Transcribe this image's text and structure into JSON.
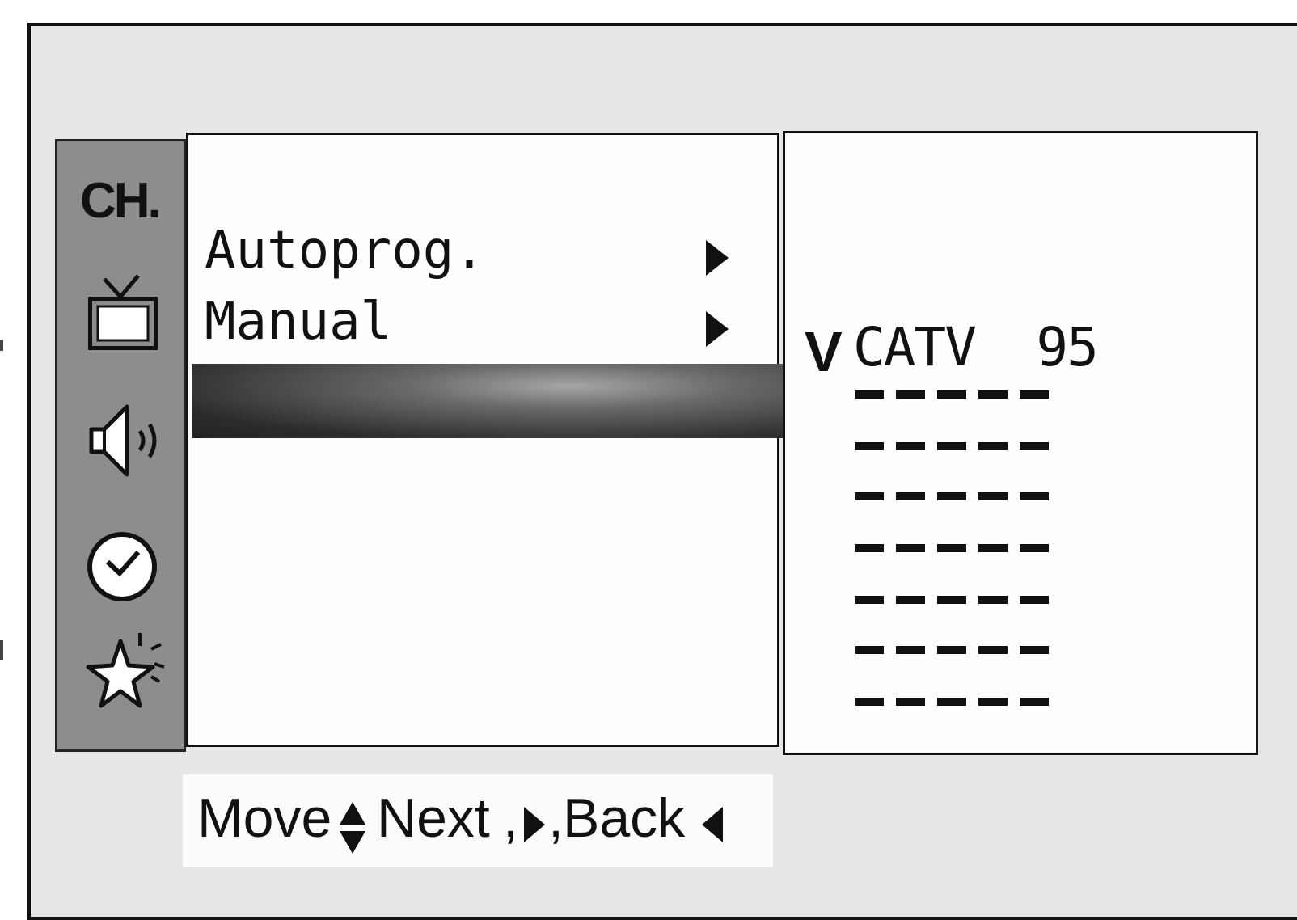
{
  "sidebar": {
    "category_label": "CH.",
    "icons": [
      "tv-icon",
      "speaker-icon",
      "clock-icon",
      "star-icon"
    ]
  },
  "menu": {
    "items": [
      {
        "label": "Autoprog."
      },
      {
        "label": "Manual"
      }
    ]
  },
  "channel_list": {
    "selected_marker": "V",
    "selected_channel": "CATV  95",
    "empty_slot_count": 7
  },
  "footer": {
    "move_label": "Move",
    "next_label": "Next",
    "back_label": "Back"
  }
}
